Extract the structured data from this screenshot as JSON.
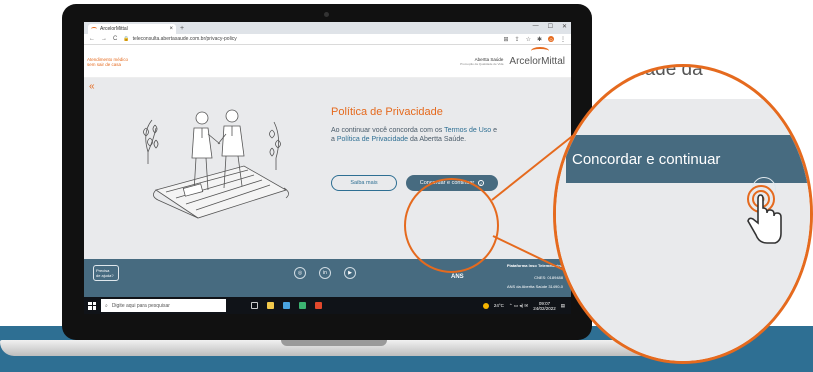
{
  "browser": {
    "tab_title": "ArcelorMittal",
    "tab_close": "×",
    "new_tab": "+",
    "url": "teleconsulta.abertasaude.com.br/privacy-policy",
    "back": "←",
    "forward": "→",
    "reload": "C",
    "profile_initial": "O",
    "win_minimize": "—",
    "win_maximize": "☐",
    "win_close": "✕"
  },
  "header": {
    "left_line1": "Atendimento médico",
    "left_line2": "sem sair de casa",
    "abertta_name": "Abertta Saúde",
    "abertta_tagline": "Promoção da Qualidade de Vida",
    "brand": "ArcelorMittal"
  },
  "main": {
    "back_arrows": "«",
    "title": "Política de Privacidade",
    "body_prefix": "Ao continuar você concorda com os ",
    "terms_link": "Termos de Uso",
    "body_mid": " e a ",
    "policy_link": "Política de Privacidade",
    "body_suffix": " da Abertta Saúde.",
    "learn_more": "Saiba mais",
    "agree": "Concordar e continuar",
    "agree_icon": "✓"
  },
  "footer": {
    "chat_line1": "Precisa",
    "chat_line2": "de ajuda?",
    "social_icons": [
      "instagram-icon",
      "linkedin-icon",
      "youtube-icon"
    ],
    "social_glyphs": [
      "◎",
      "in",
      "▶"
    ],
    "platform": "Plataforma Inso Telemedicina",
    "ans_logo": "ANS",
    "cnpj": "CNES: 0189488",
    "ans_reg": "ANS da Abertta Saúde 31490-0"
  },
  "taskbar": {
    "search_placeholder": "Digite aqui para pesquisar",
    "weather": "24°C",
    "time": "09:07",
    "date": "24/02/2022"
  },
  "zoom": {
    "top_text": "dade da",
    "button": "Concordar e continuar",
    "check": "✓"
  },
  "colors": {
    "accent_orange": "#e56a1e",
    "primary_blue": "#476b80",
    "band_blue": "#2e6f93"
  }
}
